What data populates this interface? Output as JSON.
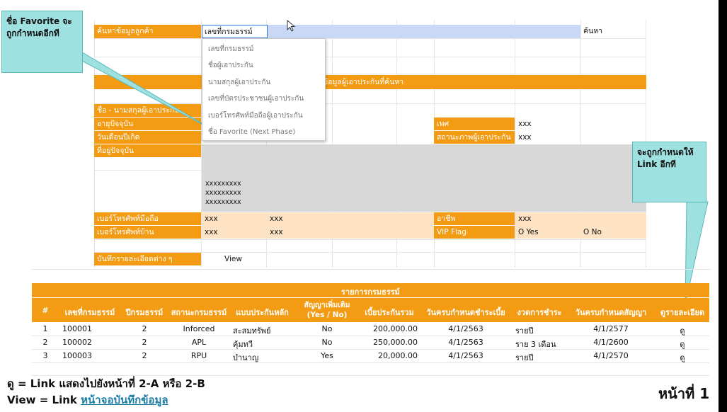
{
  "search": {
    "label": "ค้นหาข้อมูลลูกค้า",
    "field_value": "เลขที่กรมธรรม์",
    "button": "ค้นหา"
  },
  "dropdown_options": [
    "เลขที่กรมธรรม์",
    "ชื่อผู้เอาประกัน",
    "นามสกุลผู้เอาประกัน",
    "เลขที่บัตรประชาชนผู้เอาประกัน",
    "เบอร์โทรศัพท์มือถือผู้เอาประกัน",
    "ชื่อ Favorite (Next Phase)"
  ],
  "section_title": "ข้อมูลผู้เอาประกันที่ค้นหา",
  "fields": {
    "name": "ชื่อ - นามสกุลผู้เอาประกัน",
    "age": "อายุปัจจุบัน",
    "dob": "วันเดือนปีเกิด",
    "address": "ที่อยู่ปัจจุบัน",
    "gender": "เพศ",
    "gender_value": "xxx",
    "status": "สถานะภาพผู้เอาประกัน",
    "status_value": "xxx",
    "address_lines": [
      "xxxxxxxxx",
      "xxxxxxxxx",
      "xxxxxxxxx"
    ],
    "mobile": "เบอร์โทรศัพท์มือถือ",
    "mobile_v1": "xxx",
    "mobile_v2": "xxx",
    "home": "เบอร์โทรศัพท์บ้าน",
    "home_v1": "xxx",
    "home_v2": "xxx",
    "occupation": "อาชีพ",
    "occupation_value": "xxx",
    "vip": "VIP Flag",
    "vip_yes": "O Yes",
    "vip_no": "O No",
    "notes": "บันทึกรายละเอียดต่าง ๆ",
    "view": "View"
  },
  "callouts": {
    "favorite": "ชื่อ Favorite จะถูกกำหนดอีกที",
    "link": "จะถูกกำหนดให้ Link อีกที"
  },
  "policy_table": {
    "title": "รายการกรมธรรม์",
    "headers": [
      "#",
      "เลขที่กรมธรรม์",
      "ปีกรมธรรม์",
      "สถานะกรมธรรม์",
      "แบบประกันหลัก",
      "สัญญาเพิ่มเติม (Yes / No)",
      "เบี้ยประกันรวม",
      "วันครบกำหนดชำระเบี้ย",
      "งวดการชำระ",
      "วันครบกำหนดสัญญา",
      "ดูรายละเอียด"
    ],
    "rows": [
      [
        "1",
        "100001",
        "2",
        "Inforced",
        "สะสมทรัพย์",
        "No",
        "200,000.00",
        "4/1/2563",
        "รายปี",
        "4/1/2577",
        "ดู"
      ],
      [
        "2",
        "100002",
        "2",
        "APL",
        "คุ้มทวี",
        "No",
        "250,000.00",
        "4/1/2563",
        "ราย 3 เดือน",
        "4/1/2600",
        "ดู"
      ],
      [
        "3",
        "100003",
        "2",
        "RPU",
        "บำนาญ",
        "Yes",
        "20,000.00",
        "4/1/2563",
        "รายปี",
        "4/1/2570",
        "ดู"
      ]
    ]
  },
  "footer": {
    "line1": "ดู = Link แสดงไปยังหน้าที่ 2-A หรือ 2-B",
    "line2_prefix": "View = Link ",
    "line2_link": "หน้าจอบันทึกข้อมูล",
    "page_label": "หน้าที่ 1"
  },
  "colors": {
    "orange": "#f39b13",
    "pale": "#fde2c4",
    "gray": "#d8d8d8",
    "callout": "#9fe0e0",
    "search_blue": "#c9d9f5"
  }
}
